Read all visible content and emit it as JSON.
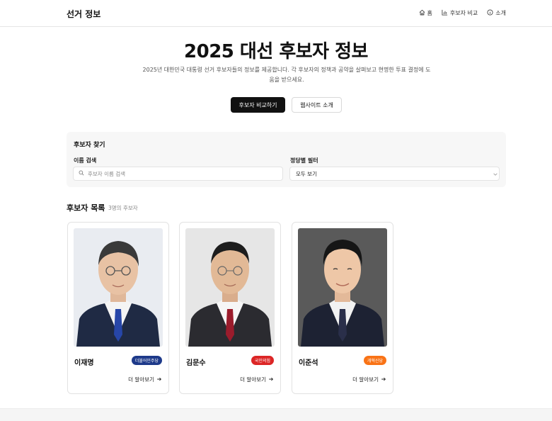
{
  "header": {
    "logo": "선거 정보",
    "nav": [
      {
        "label": "홈",
        "icon": "home-icon"
      },
      {
        "label": "후보자 비교",
        "icon": "bar-chart-icon"
      },
      {
        "label": "소개",
        "icon": "info-icon"
      }
    ]
  },
  "hero": {
    "title": "2025 대선 후보자 정보",
    "description": "2025년 대한민국 대통령 선거 후보자들의 정보를 제공합니다. 각 후보자의 정책과 공약을 살펴보고 현명한 투표 결정에 도움을 받으세요.",
    "primary_button": "후보자 비교하기",
    "secondary_button": "웹사이트 소개"
  },
  "search": {
    "title": "후보자 찾기",
    "name_label": "이름 검색",
    "name_placeholder": "후보자 이름 검색",
    "party_label": "정당별 필터",
    "party_selected": "모두 보기"
  },
  "list": {
    "title": "후보자 목록",
    "count": "3명의 후보자",
    "more_label": "더 알아보기",
    "candidates": [
      {
        "name": "이재명",
        "party": "더불어민주당",
        "party_color": "#1e3a8a",
        "tie_color": "#2746a8",
        "photo_bg": "#e9ecf1"
      },
      {
        "name": "김문수",
        "party": "국민의힘",
        "party_color": "#dc2626",
        "tie_color": "#9b1c2c",
        "photo_bg": "#e6e6e6"
      },
      {
        "name": "이준석",
        "party": "개혁신당",
        "party_color": "#f97316",
        "tie_color": "#2a2f4a",
        "photo_bg": "#5a5a5a"
      }
    ]
  }
}
